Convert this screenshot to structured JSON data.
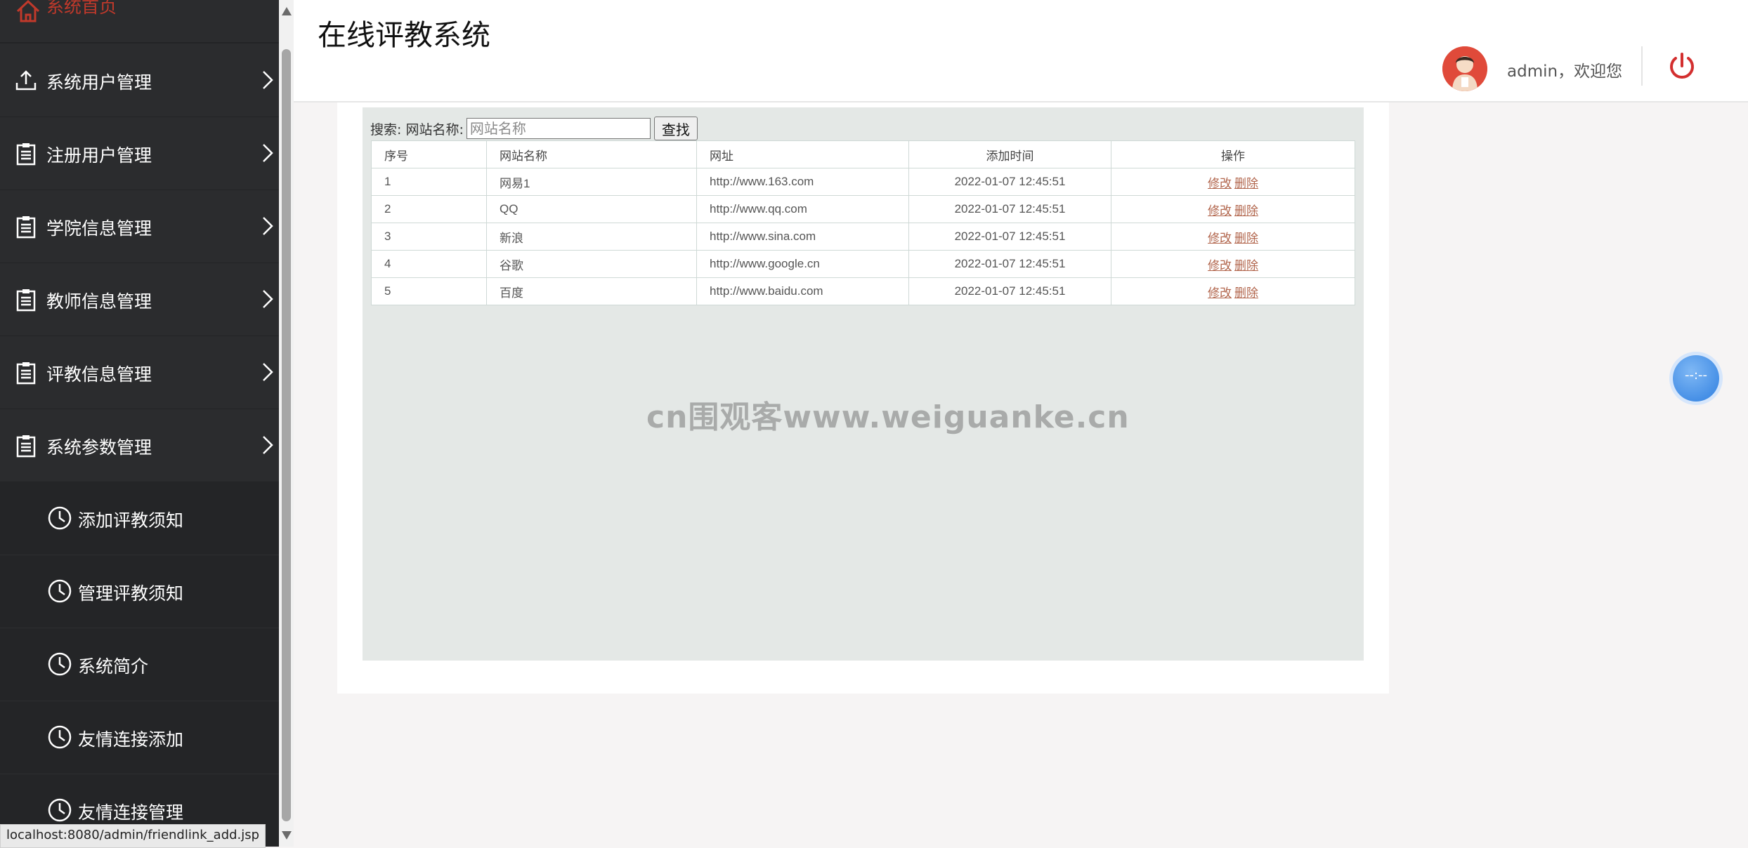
{
  "sidebar": {
    "home_label": "系统首页",
    "items": [
      {
        "label": "系统用户管理",
        "icon": "upload-icon"
      },
      {
        "label": "注册用户管理",
        "icon": "clipboard-icon"
      },
      {
        "label": "学院信息管理",
        "icon": "clipboard-icon"
      },
      {
        "label": "教师信息管理",
        "icon": "clipboard-icon"
      },
      {
        "label": "评教信息管理",
        "icon": "clipboard-icon"
      },
      {
        "label": "系统参数管理",
        "icon": "clipboard-icon"
      }
    ],
    "sub_items": [
      {
        "label": "添加评教须知",
        "icon": "clock-icon"
      },
      {
        "label": "管理评教须知",
        "icon": "clock-icon"
      },
      {
        "label": "系统简介",
        "icon": "clock-icon"
      },
      {
        "label": "友情连接添加",
        "icon": "clock-icon"
      },
      {
        "label": "友情连接管理",
        "icon": "clock-icon"
      }
    ]
  },
  "header": {
    "title": "在线评教系统",
    "welcome": "admin，欢迎您"
  },
  "search": {
    "label": "搜索: 网站名称:",
    "placeholder": "网站名称",
    "button": "查找"
  },
  "table": {
    "headers": [
      "序号",
      "网站名称",
      "网址",
      "添加时间",
      "操作"
    ],
    "rows": [
      {
        "id": "1",
        "name": "网易1",
        "url": "http://www.163.com",
        "time": "2022-01-07 12:45:51"
      },
      {
        "id": "2",
        "name": "QQ",
        "url": "http://www.qq.com",
        "time": "2022-01-07 12:45:51"
      },
      {
        "id": "3",
        "name": "新浪",
        "url": "http://www.sina.com",
        "time": "2022-01-07 12:45:51"
      },
      {
        "id": "4",
        "name": "谷歌",
        "url": "http://www.google.cn",
        "time": "2022-01-07 12:45:51"
      },
      {
        "id": "5",
        "name": "百度",
        "url": "http://www.baidu.com",
        "time": "2022-01-07 12:45:51"
      }
    ],
    "edit_label": "修改",
    "delete_label": "删除"
  },
  "watermark": "cn围观客www.weiguanke.cn",
  "float_button": "--:--",
  "status_url": "localhost:8080/admin/friendlink_add.jsp",
  "colors": {
    "sidebar_bg": "#2b2c2e",
    "accent_red": "#c0392b",
    "link": "#b2664d"
  }
}
